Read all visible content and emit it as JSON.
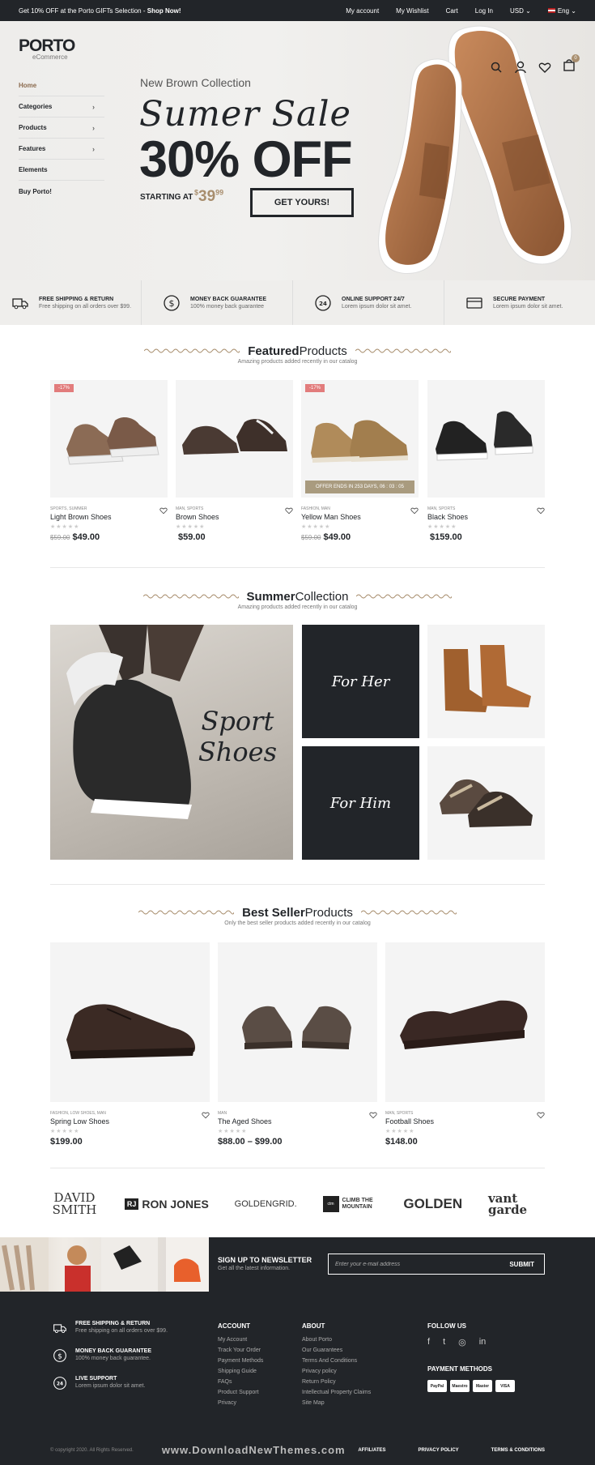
{
  "topbar": {
    "promo_prefix": "Get 10% OFF at the Porto GIFTs Selection - ",
    "promo_link": "Shop Now!",
    "links": [
      "My account",
      "My Wishlist",
      "Cart",
      "Log In",
      "USD ⌄",
      "Eng ⌄"
    ]
  },
  "logo": {
    "name": "PORTO",
    "tagline": "eCommerce"
  },
  "nav": [
    "Home",
    "Categories",
    "Products",
    "Features",
    "Elements",
    "Buy Porto!"
  ],
  "cart_count": "0",
  "hero": {
    "subtitle": "New Brown Collection",
    "script": "Sumer Sale",
    "big": "30% OFF",
    "starting": "STARTING AT",
    "price_currency": "$",
    "price_main": "39",
    "price_cents": "99",
    "button": "GET YOURS!"
  },
  "features": [
    {
      "title": "FREE SHIPPING & RETURN",
      "sub": "Free shipping on all orders over $99.",
      "icon": "truck-icon"
    },
    {
      "title": "MONEY BACK GUARANTEE",
      "sub": "100% money back guarantee",
      "icon": "dollar-icon"
    },
    {
      "title": "ONLINE SUPPORT 24/7",
      "sub": "Lorem ipsum dolor sit amet.",
      "icon": "support-24-icon"
    },
    {
      "title": "SECURE PAYMENT",
      "sub": "Lorem ipsum dolor sit amet.",
      "icon": "card-icon"
    }
  ],
  "featured": {
    "title_bold": "Featured",
    "title_rest": "Products",
    "sub": "Amazing products added recently in our catalog",
    "items": [
      {
        "badge": "-17%",
        "cat": "SPORTS, SUMMER",
        "name": "Light Brown Shoes",
        "old": "$59.00",
        "price": "$49.00"
      },
      {
        "badge": "",
        "cat": "MAN, SPORTS",
        "name": "Brown Shoes",
        "old": "",
        "price": "$59.00"
      },
      {
        "badge": "-17%",
        "cat": "FASHION, MAN",
        "name": "Yellow Man Shoes",
        "old": "$59.00",
        "price": "$49.00",
        "timer": "OFFER ENDS IN 253 DAYS, 06 : 03 : 05"
      },
      {
        "badge": "",
        "cat": "MAN, SPORTS",
        "name": "Black Shoes",
        "old": "",
        "price": "$159.00"
      }
    ]
  },
  "summer": {
    "title_bold": "Summer",
    "title_rest": "Collection",
    "sub": "Amazing products added recently in our catalog",
    "sport_line1": "Sport",
    "sport_line2": "Shoes",
    "her": "For Her",
    "him": "For Him"
  },
  "bestseller": {
    "title_bold": "Best Seller",
    "title_rest": "Products",
    "sub": "Only the best seller products added recently in our catalog",
    "items": [
      {
        "cat": "FASHION, LOW SHOES, MAN",
        "name": "Spring Low Shoes",
        "price": "$199.00"
      },
      {
        "cat": "MAN",
        "name": "The Aged Shoes",
        "price": "$88.00 – $99.00"
      },
      {
        "cat": "MAN, SPORTS",
        "name": "Football Shoes",
        "price": "$148.00"
      }
    ]
  },
  "brands": [
    "DAVID SMITH",
    "RON JONES",
    "GOLDENGRID.",
    "CLIMB THE MOUNTAIN",
    "GOLDEN",
    "vant garde"
  ],
  "newsletter": {
    "title": "SIGN UP TO NEWSLETTER",
    "sub": "Get all the latest information.",
    "placeholder": "Enter your e-mail address",
    "button": "SUBMIT"
  },
  "footer": {
    "features": [
      {
        "title": "FREE SHIPPING & RETURN",
        "sub": "Free shipping on all orders over $99."
      },
      {
        "title": "MONEY BACK GUARANTEE",
        "sub": "100% money back guarantee."
      },
      {
        "title": "LIVE SUPPORT",
        "sub": "Lorem ipsum dolor sit amet."
      }
    ],
    "account_title": "ACCOUNT",
    "account": [
      "My Account",
      "Track Your Order",
      "Payment Methods",
      "Shipping Guide",
      "FAQs",
      "Product Support",
      "Privacy"
    ],
    "about_title": "ABOUT",
    "about": [
      "About Porto",
      "Our Guarantees",
      "Terms And Conditions",
      "Privacy policy",
      "Return Policy",
      "Intellectual Property Claims",
      "Site Map"
    ],
    "follow_title": "FOLLOW US",
    "social": [
      "f",
      "t",
      "◎",
      "in"
    ],
    "payment_title": "PAYMENT METHODS",
    "payment": [
      "PayPal",
      "Maestro",
      "Master",
      "VISA"
    ],
    "copyright": "© copyright 2020. All Rights Reserved.",
    "watermark": "www.DownloadNewThemes.com",
    "bottom_links": [
      "AFFILIATES",
      "PRIVACY POLICY",
      "TERMS & CONDITIONS"
    ]
  }
}
